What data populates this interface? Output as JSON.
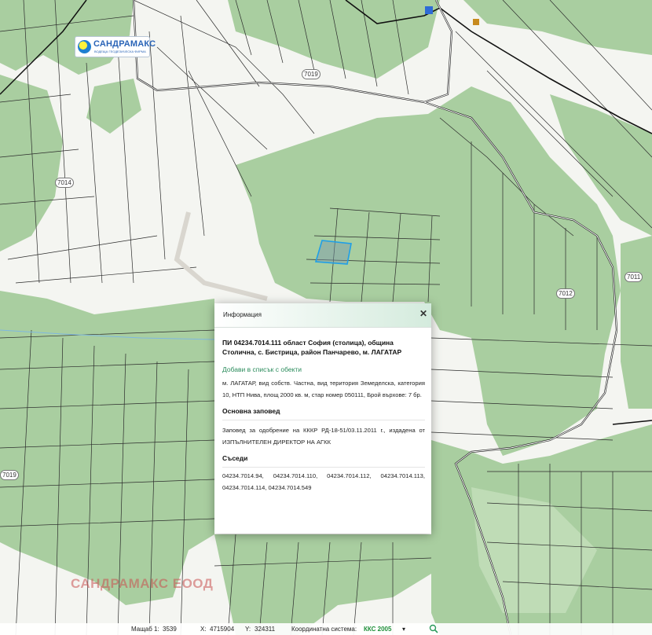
{
  "logo": {
    "name": "САНДРАМАКС",
    "tagline": "ВОДЕЩА ГЕОДЕЗИЧЕСКА ФИРМА"
  },
  "watermark": "САНДРАМАКС ЕООД",
  "road_labels": [
    "7019",
    "7014",
    "7011",
    "7012",
    "7019"
  ],
  "colors": {
    "forest": "#a9cea0",
    "forest_dark": "#9cc593",
    "land": "#f4f5f1",
    "road": "#1a1a1a",
    "parcel_highlight": "#1e9fe8",
    "accent": "#2b8c5c"
  },
  "popup": {
    "header": "Информация",
    "close_icon": "close-icon",
    "title": "ПИ 04234.7014.111 област София (столица), община Столична, с. Бистрица, район Панчарево, м. ЛАГАТАР",
    "add_link": "Добави в списък с обекти",
    "description": "м. ЛАГАТАР, вид собств. Частна, вид територия Земеделска, категория 10, НТП Нива, площ 2000 кв. м, стар номер 050111, Брой върхове: 7 бр.",
    "order_heading": "Основна заповед",
    "order_text": "Заповед за одобрение на КККР РД-18-51/03.11.2011 г., издадена от ИЗПЪЛНИТЕЛЕН ДИРЕКТОР НА АГКК",
    "neighbors_heading": "Съседи",
    "neighbors": "04234.7014.94, 04234.7014.110, 04234.7014.112, 04234.7014.113, 04234.7014.114, 04234.7014.549"
  },
  "status": {
    "scale_label": "Мащаб 1:",
    "scale_value": "3539",
    "x_label": "X:",
    "x_value": "4715904",
    "y_label": "Y:",
    "y_value": "324311",
    "crs_label": "Координатна система:",
    "crs_value": "ККС 2005",
    "search_icon": "search-icon"
  }
}
